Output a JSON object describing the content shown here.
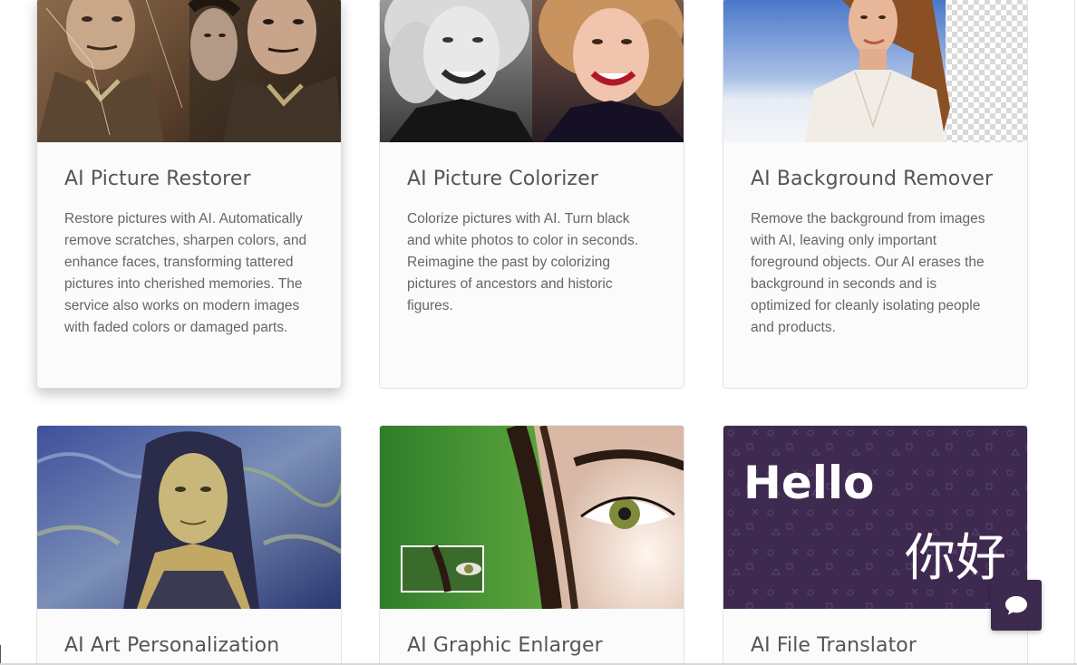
{
  "cards": [
    {
      "title": "AI Picture Restorer",
      "description": "Restore pictures with AI. Automatically remove scratches, sharpen colors, and enhance faces, transforming tattered pictures into cherished memories. The service also works on modern images with faded colors or damaged parts.",
      "image": "restored-soldier-photo"
    },
    {
      "title": "AI Picture Colorizer",
      "description": "Colorize pictures with AI. Turn black and white photos to color in seconds. Reimagine the past by colorizing pictures of ancestors and historic figures.",
      "image": "colorized-portrait-photo"
    },
    {
      "title": "AI Background Remover",
      "description": "Remove the background from images with AI, leaving only important foreground objects. Our AI erases the background in seconds and is optimized for cleanly isolating people and products.",
      "image": "background-removed-portrait"
    },
    {
      "title": "AI Art Personalization",
      "image": "mona-lisa-painting-style"
    },
    {
      "title": "AI Graphic Enlarger",
      "image": "eye-closeup-enlarged"
    },
    {
      "title": "AI File Translator",
      "image": "hello-translation-graphic",
      "image_text_en": "Hello",
      "image_text_zh": "你好"
    }
  ],
  "chat_widget": {
    "icon": "chat-bubble-icon",
    "color": "#3d2a4e"
  }
}
